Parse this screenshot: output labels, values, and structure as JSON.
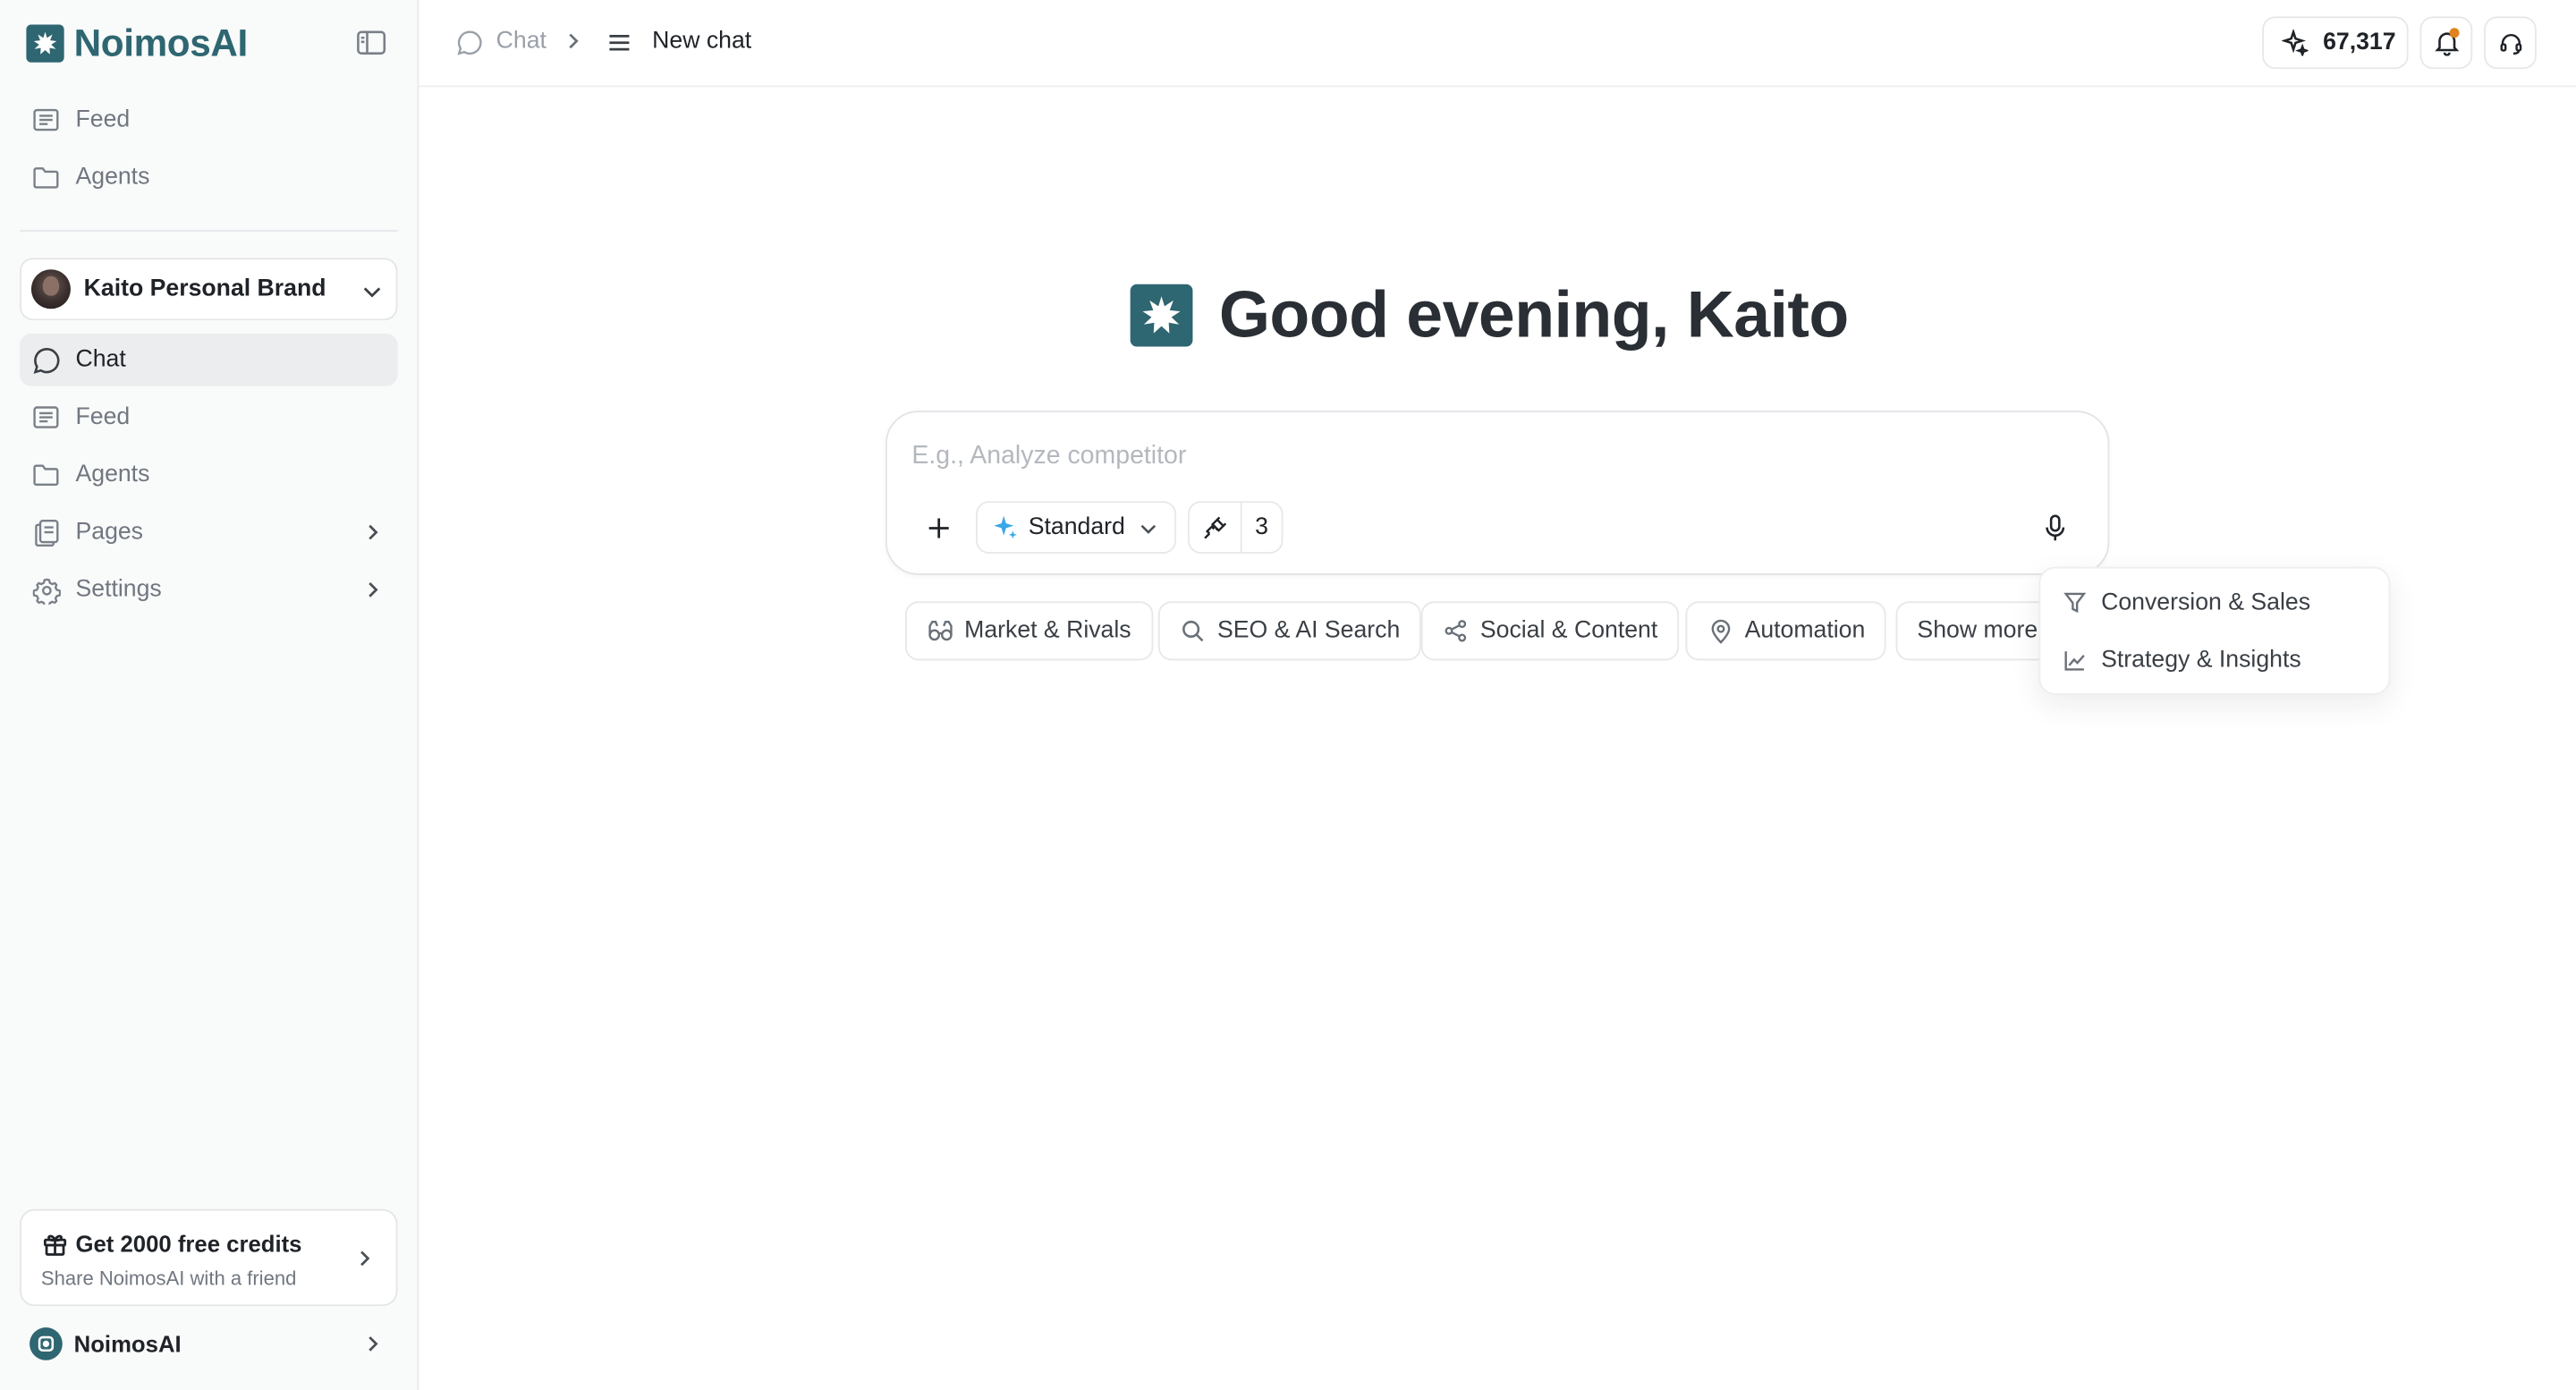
{
  "brand": {
    "name": "NoimosAI"
  },
  "sidebar": {
    "top_items": [
      {
        "label": "Feed",
        "icon": "feed-icon"
      },
      {
        "label": "Agents",
        "icon": "folder-icon"
      }
    ],
    "workspace": {
      "name": "Kaito Personal Brand"
    },
    "items": [
      {
        "label": "Chat",
        "icon": "chat-bubble-icon",
        "active": true
      },
      {
        "label": "Feed",
        "icon": "feed-icon"
      },
      {
        "label": "Agents",
        "icon": "folder-icon"
      },
      {
        "label": "Pages",
        "icon": "pages-icon",
        "has_submenu": true
      },
      {
        "label": "Settings",
        "icon": "gear-icon",
        "has_submenu": true
      }
    ],
    "promo": {
      "title": "Get 2000 free credits",
      "subtitle": "Share NoimosAI with a friend"
    },
    "account": {
      "name": "NoimosAI"
    }
  },
  "topbar": {
    "breadcrumb_root": "Chat",
    "breadcrumb_current": "New chat",
    "credits": "67,317",
    "notification_dot_color": "#e0821e"
  },
  "main": {
    "greeting": "Good evening, Kaito",
    "composer": {
      "placeholder": "E.g., Analyze competitor",
      "value": "",
      "model": "Standard",
      "tools_count": "3"
    },
    "chips": [
      {
        "label": "Market & Rivals",
        "icon": "binoculars-icon"
      },
      {
        "label": "SEO & AI Search",
        "icon": "search-icon"
      },
      {
        "label": "Social & Content",
        "icon": "share-icon"
      },
      {
        "label": "Automation",
        "icon": "map-pin-icon"
      },
      {
        "label": "Show more"
      }
    ],
    "more_menu": [
      {
        "label": "Conversion & Sales",
        "icon": "funnel-icon"
      },
      {
        "label": "Strategy & Insights",
        "icon": "line-chart-icon"
      }
    ]
  },
  "colors": {
    "brand": "#2e6671",
    "accent_spark": "#3aa7e6",
    "active_nav_bg": "#ebedee"
  }
}
